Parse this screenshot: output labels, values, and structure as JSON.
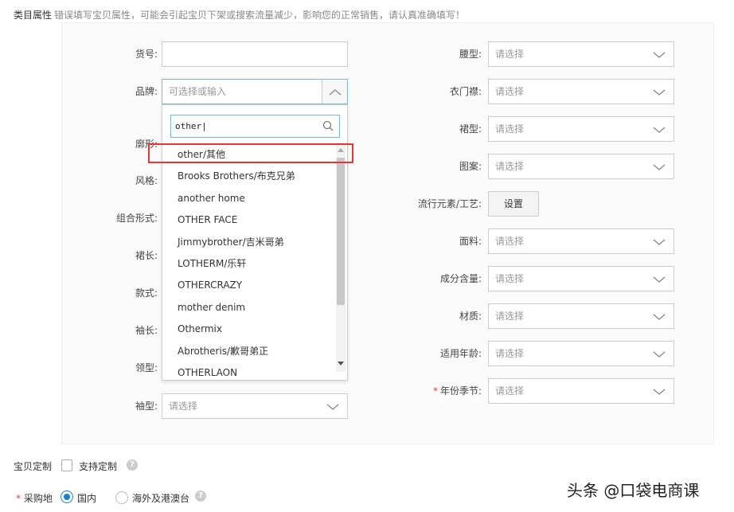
{
  "header": {
    "label": "类目属性",
    "hint": "错误填写宝贝属性，可能会引起宝贝下架或搜索流量减少，影响您的正常销售，请认真准确填写！"
  },
  "left_fields": [
    {
      "label": "货号:",
      "value": ""
    },
    {
      "label": "品牌:",
      "placeholder": "可选择或输入"
    },
    {
      "label": "廓形:"
    },
    {
      "label": "风格:"
    },
    {
      "label": "组合形式:"
    },
    {
      "label": "裙长:"
    },
    {
      "label": "款式:"
    },
    {
      "label": "袖长:"
    },
    {
      "label": "领型:"
    },
    {
      "label": "袖型:",
      "placeholder": "请选择"
    }
  ],
  "right_fields": [
    {
      "label": "腰型:",
      "placeholder": "请选择"
    },
    {
      "label": "衣门襟:",
      "placeholder": "请选择"
    },
    {
      "label": "裙型:",
      "placeholder": "请选择"
    },
    {
      "label": "图案:",
      "placeholder": "请选择"
    },
    {
      "label": "流行元素/工艺:",
      "button": "设置"
    },
    {
      "label": "面料:",
      "placeholder": "请选择"
    },
    {
      "label": "成分含量:",
      "placeholder": "请选择"
    },
    {
      "label": "材质:",
      "placeholder": "请选择"
    },
    {
      "label": "适用年龄:",
      "placeholder": "请选择"
    },
    {
      "label": "年份季节:",
      "placeholder": "请选择",
      "required": "*"
    }
  ],
  "brand_dropdown": {
    "search_value": "other|",
    "items": [
      "other/其他",
      "Brooks Brothers/布克兄弟",
      "another home",
      "OTHER FACE",
      "Jimmybrother/吉米哥弟",
      "LOTHERM/乐轩",
      "OTHERCRAZY",
      "mother denim",
      "Othermix",
      "Abrotheris/歉哥弟正",
      "OTHERLAON"
    ],
    "highlight_color": "#e5363b"
  },
  "customize": {
    "label": "宝贝定制",
    "checkbox_label": "支持定制",
    "checked": false
  },
  "purchase": {
    "required": "*",
    "label": "采购地",
    "options": [
      "国内",
      "海外及港澳台"
    ],
    "selected": "国内"
  },
  "watermark": "头条 @口袋电商课"
}
